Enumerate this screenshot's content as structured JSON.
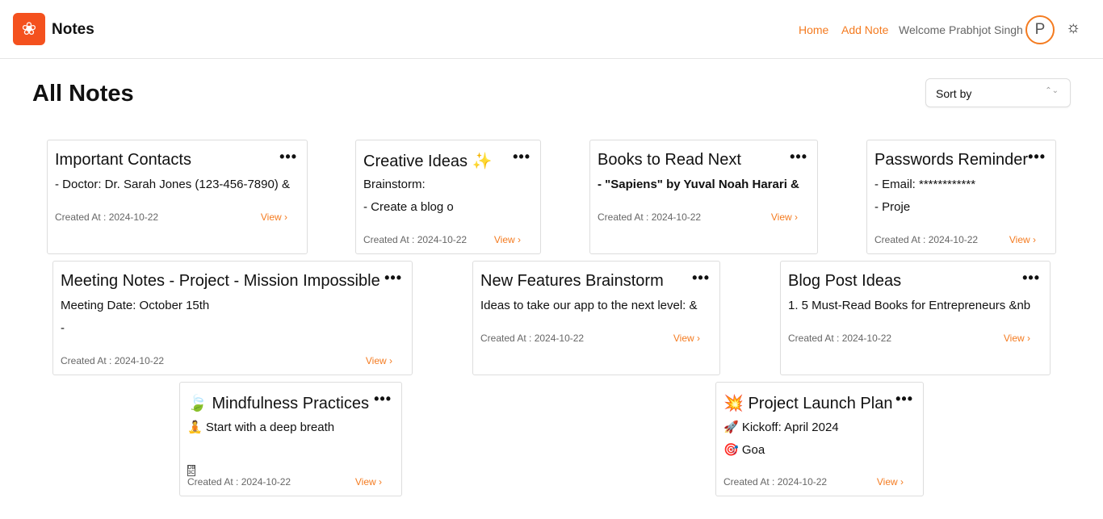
{
  "nav": {
    "brand": "Notes",
    "home": "Home",
    "add_note": "Add Note",
    "welcome": "Welcome Prabhjot Singh",
    "avatar_initial": "P",
    "theme_icon": "sun-icon",
    "accent": "#f47b20"
  },
  "page": {
    "title": "All Notes",
    "sort_placeholder": "Sort by"
  },
  "notes": [
    {
      "title": "Important Contacts",
      "lines": [
        "- Doctor: Dr. Sarah Jones (123-456-7890) &"
      ],
      "created": "Created At : 2024-10-22",
      "view": "View"
    },
    {
      "title": "Creative Ideas ✨",
      "lines": [
        "Brainstorm:",
        "- Create a blog o"
      ],
      "created": "Created At : 2024-10-22",
      "view": "View"
    },
    {
      "title": "Books to Read Next",
      "lines": [
        "- \"Sapiens\" by Yuval Noah Harari &"
      ],
      "created": "Created At : 2024-10-22",
      "view": "View"
    },
    {
      "title": "Passwords Reminder",
      "lines": [
        "- Email: ************",
        "- Proje"
      ],
      "created": "Created At : 2024-10-22",
      "view": "View"
    },
    {
      "title": "Meeting Notes - Project - Mission Impossible",
      "lines": [
        "Meeting Date: October 15th",
        "-"
      ],
      "created": "Created At : 2024-10-22",
      "view": "View"
    },
    {
      "title": "New Features Brainstorm",
      "lines": [
        "Ideas to take our app to the next level: &"
      ],
      "created": "Created At : 2024-10-22",
      "view": "View"
    },
    {
      "title": "Blog Post Ideas",
      "lines": [
        "1. 5 Must-Read Books for Entrepreneurs &nb"
      ],
      "created": "Created At : 2024-10-22",
      "view": "View"
    },
    {
      "title": "🍃 Mindfulness Practices",
      "lines": [
        "🧘 Start with a deep breath",
        ""
      ],
      "created": "Created At : 2024-10-22",
      "view": "View"
    },
    {
      "title": "💥 Project Launch Plan",
      "lines": [
        "🚀 Kickoff: April 2024",
        "🎯 Goa"
      ],
      "created": "Created At : 2024-10-22",
      "view": "View"
    }
  ]
}
